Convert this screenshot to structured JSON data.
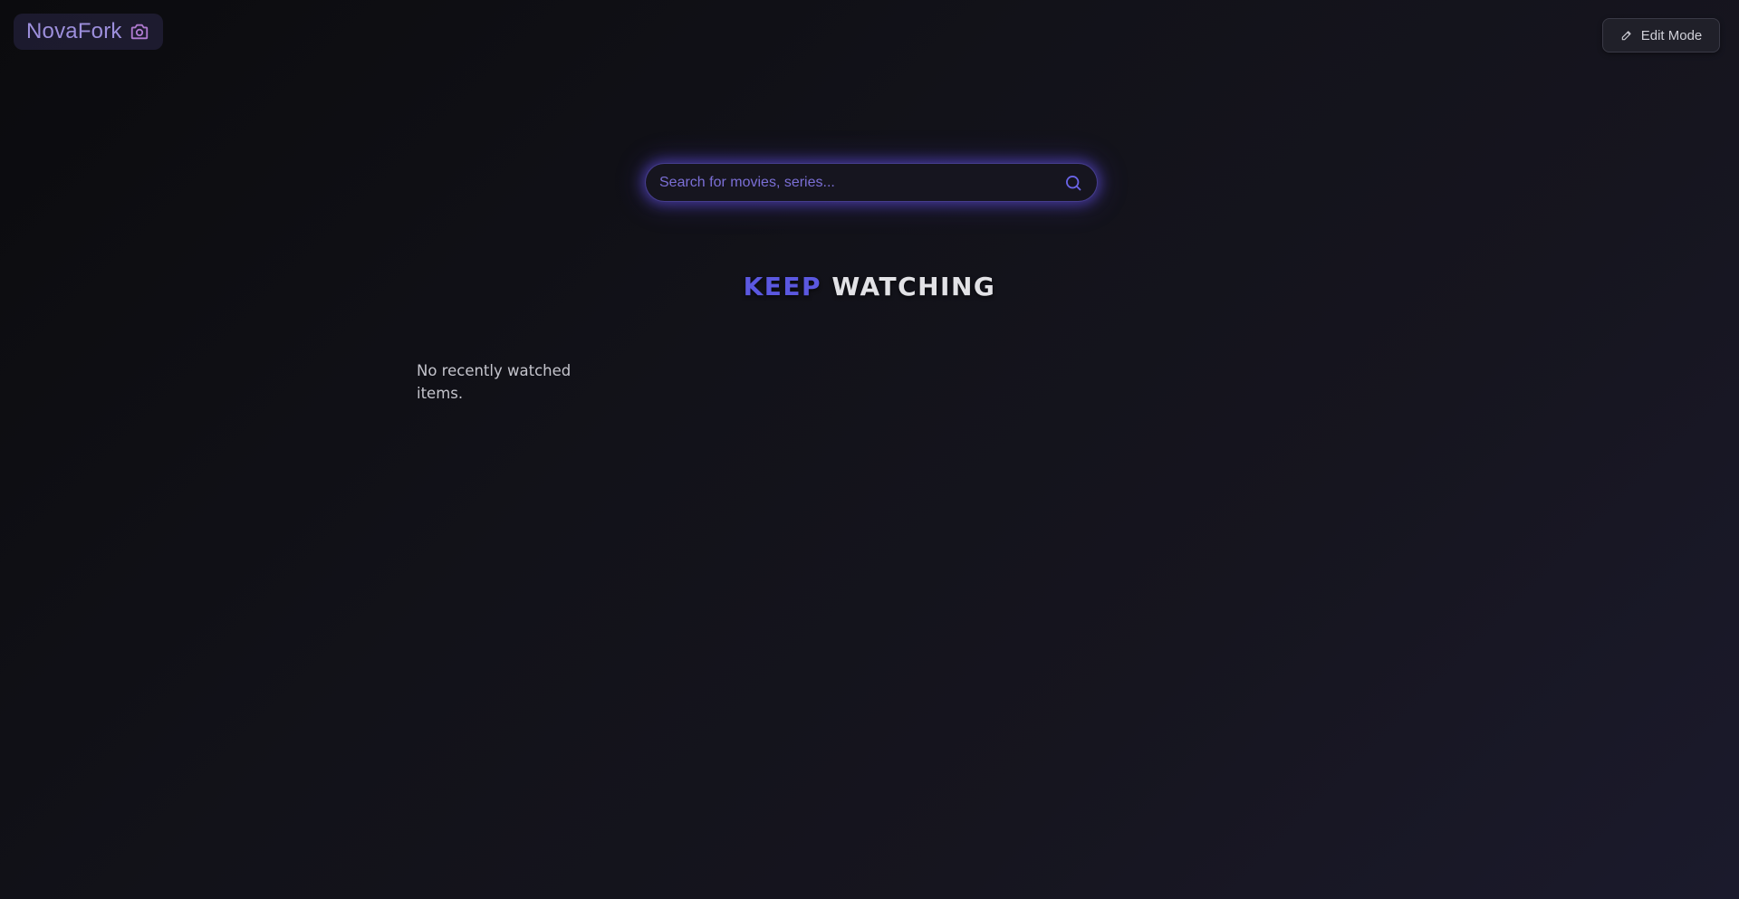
{
  "header": {
    "logo_text": "NovaFork",
    "logo_icon": "camera-icon",
    "edit_button_label": "Edit Mode",
    "edit_button_icon": "pencil-icon"
  },
  "search": {
    "placeholder": "Search for movies, series...",
    "value": "",
    "icon": "search-icon"
  },
  "keep_watching": {
    "title_accent": "KEEP",
    "title_rest": "WATCHING",
    "empty_message": "No recently watched items."
  },
  "colors": {
    "accent": "#5b58e0",
    "logo": "#9d8fdc",
    "logo_icon": "#b07ad0",
    "search_glow": "#6350e6",
    "background_start": "#0b0b0e",
    "background_end": "#1b1a2c"
  }
}
